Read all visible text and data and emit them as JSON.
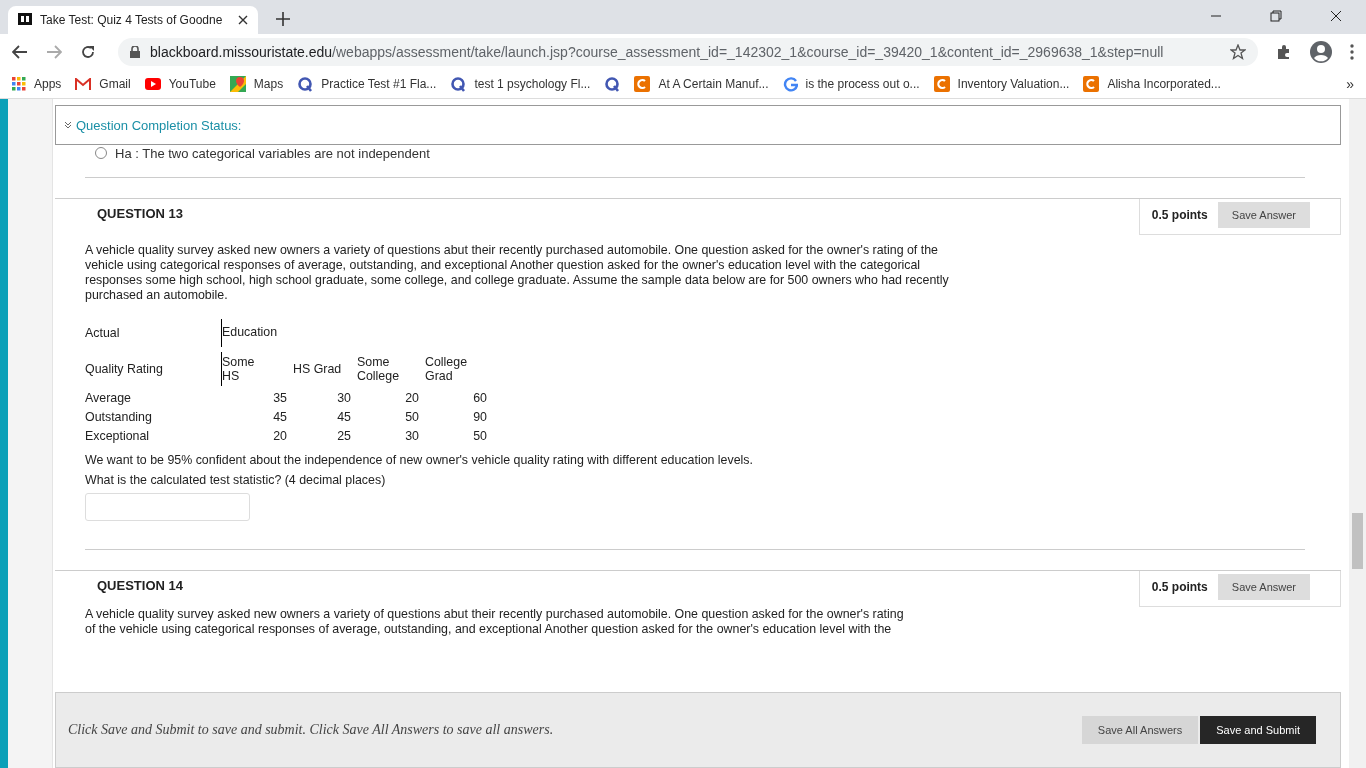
{
  "browser": {
    "tab_title": "Take Test: Quiz 4 Tests of Goodne",
    "url_host": "blackboard.missouristate.edu",
    "url_path": "/webapps/assessment/take/launch.jsp?course_assessment_id=_142302_1&course_id=_39420_1&content_id=_2969638_1&step=null",
    "bookmarks": [
      {
        "kind": "apps",
        "label": "Apps"
      },
      {
        "kind": "gmail",
        "label": "Gmail"
      },
      {
        "kind": "youtube",
        "label": "YouTube"
      },
      {
        "kind": "maps",
        "label": "Maps"
      },
      {
        "kind": "quizlet",
        "label": "Practice Test #1 Fla..."
      },
      {
        "kind": "quizlet",
        "label": "test 1 psychology Fl..."
      },
      {
        "kind": "quizlet"
      },
      {
        "kind": "chegg",
        "label": "At A Certain Manuf..."
      },
      {
        "kind": "google",
        "label": "is the process out o..."
      },
      {
        "kind": "chegg",
        "label": "Inventory Valuation..."
      },
      {
        "kind": "chegg",
        "label": "Alisha Incorporated..."
      }
    ],
    "more": "»"
  },
  "status": {
    "label": "Question Completion Status:"
  },
  "previous_option": {
    "label": "Ha : The two categorical variables are not independent",
    "selected": false
  },
  "q13": {
    "title": "QUESTION 13",
    "points": "0.5 points",
    "save": "Save Answer",
    "text": "A vehicle quality survey asked new owners a variety of questions abut their recently purchased automobile.  One question asked for the owner's rating of the vehicle using categorical responses of average, outstanding, and exceptional Another question asked for the owner's education level with the categorical responses some high school, high school graduate, some college, and college graduate.  Assume the sample data below are for 500 owners who had recently purchased an automobile.",
    "table": {
      "corner_top": "Actual",
      "corner_bottom": "Quality Rating",
      "group": "Education",
      "columns": [
        "Some HS",
        "HS Grad",
        "Some College",
        "College Grad"
      ],
      "rows": [
        {
          "label": "Average",
          "values": [
            "35",
            "30",
            "20",
            "60"
          ]
        },
        {
          "label": "Outstanding",
          "values": [
            "45",
            "45",
            "50",
            "90"
          ]
        },
        {
          "label": "Exceptional",
          "values": [
            "20",
            "25",
            "30",
            "50"
          ]
        }
      ]
    },
    "prompts": [
      "We want to be 95% confident about the independence of new owner's vehicle quality rating with different education levels.",
      "What is the calculated test statistic? (4 decimal places)"
    ]
  },
  "q14": {
    "title": "QUESTION 14",
    "points": "0.5 points",
    "save": "Save Answer",
    "lines": [
      "A vehicle quality survey asked new owners a variety of questions abut their recently purchased automobile.  One question asked for the owner's rating",
      "of the vehicle using categorical responses of average, outstanding, and exceptional Another question asked for the owner's education level with the"
    ]
  },
  "footer": {
    "hint": "Click Save and Submit to save and submit. Click Save All Answers to save all answers.",
    "save_all": "Save All Answers",
    "submit": "Save and Submit"
  }
}
